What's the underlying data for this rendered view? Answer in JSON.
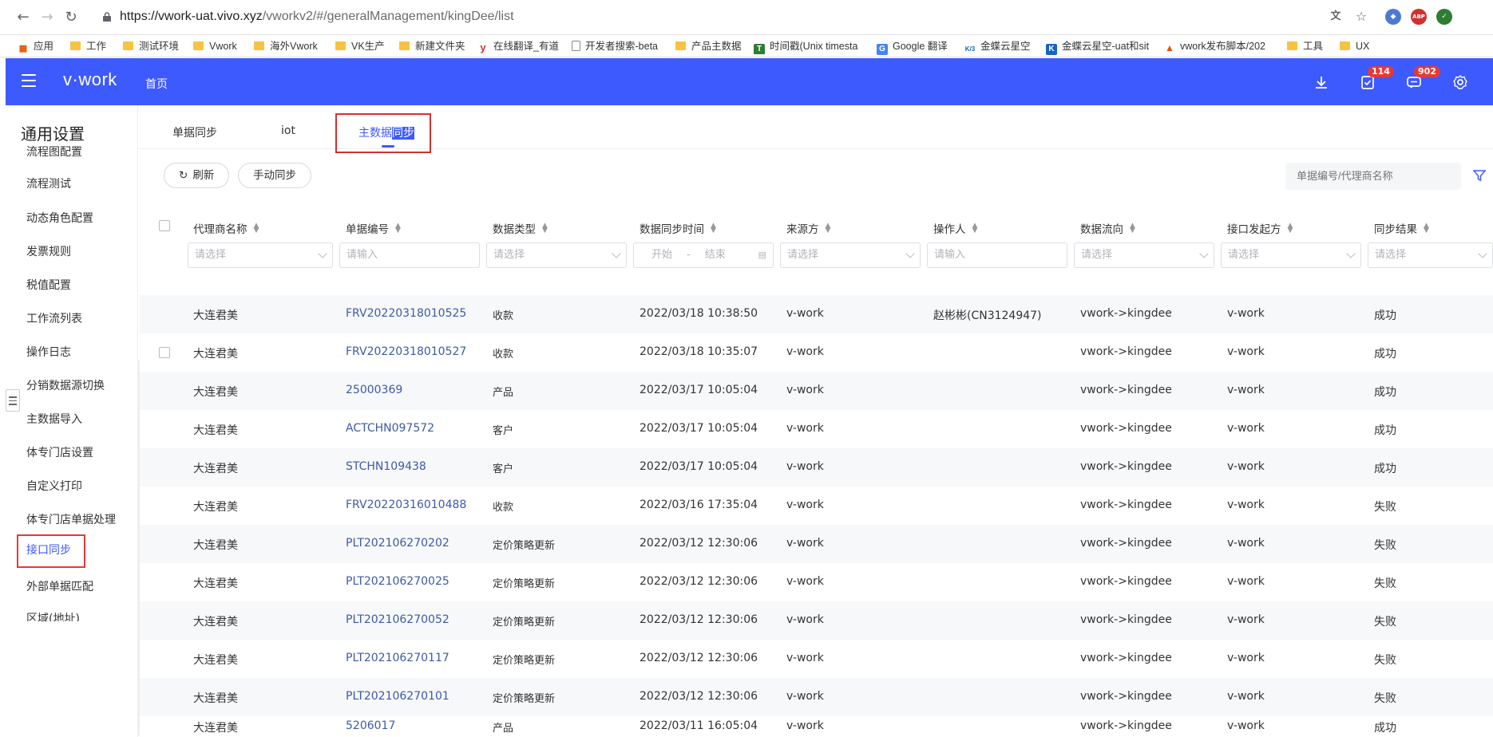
{
  "browser": {
    "url_host": "https://vwork-uat.vivo.xyz",
    "url_path": "/vworkv2/#/generalManagement/kingDee/list",
    "bookmarks": [
      "应用",
      "工作",
      "测试环境",
      "Vwork",
      "海外Vwork",
      "VK生产",
      "新建文件夹",
      "在线翻译_有道",
      "开发者搜索-beta",
      "产品主数据",
      "时间戳(Unix timesta",
      "Google 翻译",
      "金蝶云星空",
      "金蝶云星空-uat和sit",
      "vwork发布脚本/202",
      "工具",
      "UX"
    ]
  },
  "header": {
    "brand": "v·work",
    "home": "首页",
    "task_badge": "114",
    "msg_badge": "902"
  },
  "sidebar": {
    "title": "通用设置",
    "items": [
      "流程图配置",
      "流程测试",
      "动态角色配置",
      "发票规则",
      "税值配置",
      "工作流列表",
      "操作日志",
      "分销数据源切换",
      "主数据导入",
      "体专门店设置",
      "自定义打印",
      "体专门店单据处理",
      "接口同步",
      "外部单据匹配",
      "区域(地址)"
    ]
  },
  "tabs": {
    "tab1": "单据同步",
    "tab2": "iot",
    "tab3_part1": "主数据",
    "tab3_part2": "同步"
  },
  "toolbar": {
    "refresh": "刷新",
    "manual_sync": "手动同步",
    "search_placeholder": "单据编号/代理商名称"
  },
  "columns": [
    "代理商名称",
    "单据编号",
    "数据类型",
    "数据同步时间",
    "来源方",
    "操作人",
    "数据流向",
    "接口发起方",
    "同步结果"
  ],
  "filters": {
    "select": "请选择",
    "input": "请输入",
    "start": "开始",
    "dash": "-",
    "end": "结束"
  },
  "rows": [
    {
      "agent": "大连君美",
      "doc": "FRV20220318010525",
      "type": "收款",
      "time": "2022/03/18 10:38:50",
      "source": "v-work",
      "operator": "赵彬彬(CN3124947)",
      "flow": "vwork->kingdee",
      "initiator": "v-work",
      "result": "成功"
    },
    {
      "agent": "大连君美",
      "doc": "FRV20220318010527",
      "type": "收款",
      "time": "2022/03/18 10:35:07",
      "source": "v-work",
      "operator": "",
      "flow": "vwork->kingdee",
      "initiator": "v-work",
      "result": "成功"
    },
    {
      "agent": "大连君美",
      "doc": "25000369",
      "type": "产品",
      "time": "2022/03/17 10:05:04",
      "source": "v-work",
      "operator": "",
      "flow": "vwork->kingdee",
      "initiator": "v-work",
      "result": "成功"
    },
    {
      "agent": "大连君美",
      "doc": "ACTCHN097572",
      "type": "客户",
      "time": "2022/03/17 10:05:04",
      "source": "v-work",
      "operator": "",
      "flow": "vwork->kingdee",
      "initiator": "v-work",
      "result": "成功"
    },
    {
      "agent": "大连君美",
      "doc": "STCHN109438",
      "type": "客户",
      "time": "2022/03/17 10:05:04",
      "source": "v-work",
      "operator": "",
      "flow": "vwork->kingdee",
      "initiator": "v-work",
      "result": "成功"
    },
    {
      "agent": "大连君美",
      "doc": "FRV20220316010488",
      "type": "收款",
      "time": "2022/03/16 17:35:04",
      "source": "v-work",
      "operator": "",
      "flow": "vwork->kingdee",
      "initiator": "v-work",
      "result": "失败"
    },
    {
      "agent": "大连君美",
      "doc": "PLT202106270202",
      "type": "定价策略更新",
      "time": "2022/03/12 12:30:06",
      "source": "v-work",
      "operator": "",
      "flow": "vwork->kingdee",
      "initiator": "v-work",
      "result": "失败"
    },
    {
      "agent": "大连君美",
      "doc": "PLT202106270025",
      "type": "定价策略更新",
      "time": "2022/03/12 12:30:06",
      "source": "v-work",
      "operator": "",
      "flow": "vwork->kingdee",
      "initiator": "v-work",
      "result": "失败"
    },
    {
      "agent": "大连君美",
      "doc": "PLT202106270052",
      "type": "定价策略更新",
      "time": "2022/03/12 12:30:06",
      "source": "v-work",
      "operator": "",
      "flow": "vwork->kingdee",
      "initiator": "v-work",
      "result": "失败"
    },
    {
      "agent": "大连君美",
      "doc": "PLT202106270117",
      "type": "定价策略更新",
      "time": "2022/03/12 12:30:06",
      "source": "v-work",
      "operator": "",
      "flow": "vwork->kingdee",
      "initiator": "v-work",
      "result": "失败"
    },
    {
      "agent": "大连君美",
      "doc": "PLT202106270101",
      "type": "定价策略更新",
      "time": "2022/03/12 12:30:06",
      "source": "v-work",
      "operator": "",
      "flow": "vwork->kingdee",
      "initiator": "v-work",
      "result": "失败"
    },
    {
      "agent": "大连君美",
      "doc": "5206017",
      "type": "产品",
      "time": "2022/03/11 16:05:04",
      "source": "v-work",
      "operator": "",
      "flow": "vwork->kingdee",
      "initiator": "v-work",
      "result": "成功"
    }
  ]
}
